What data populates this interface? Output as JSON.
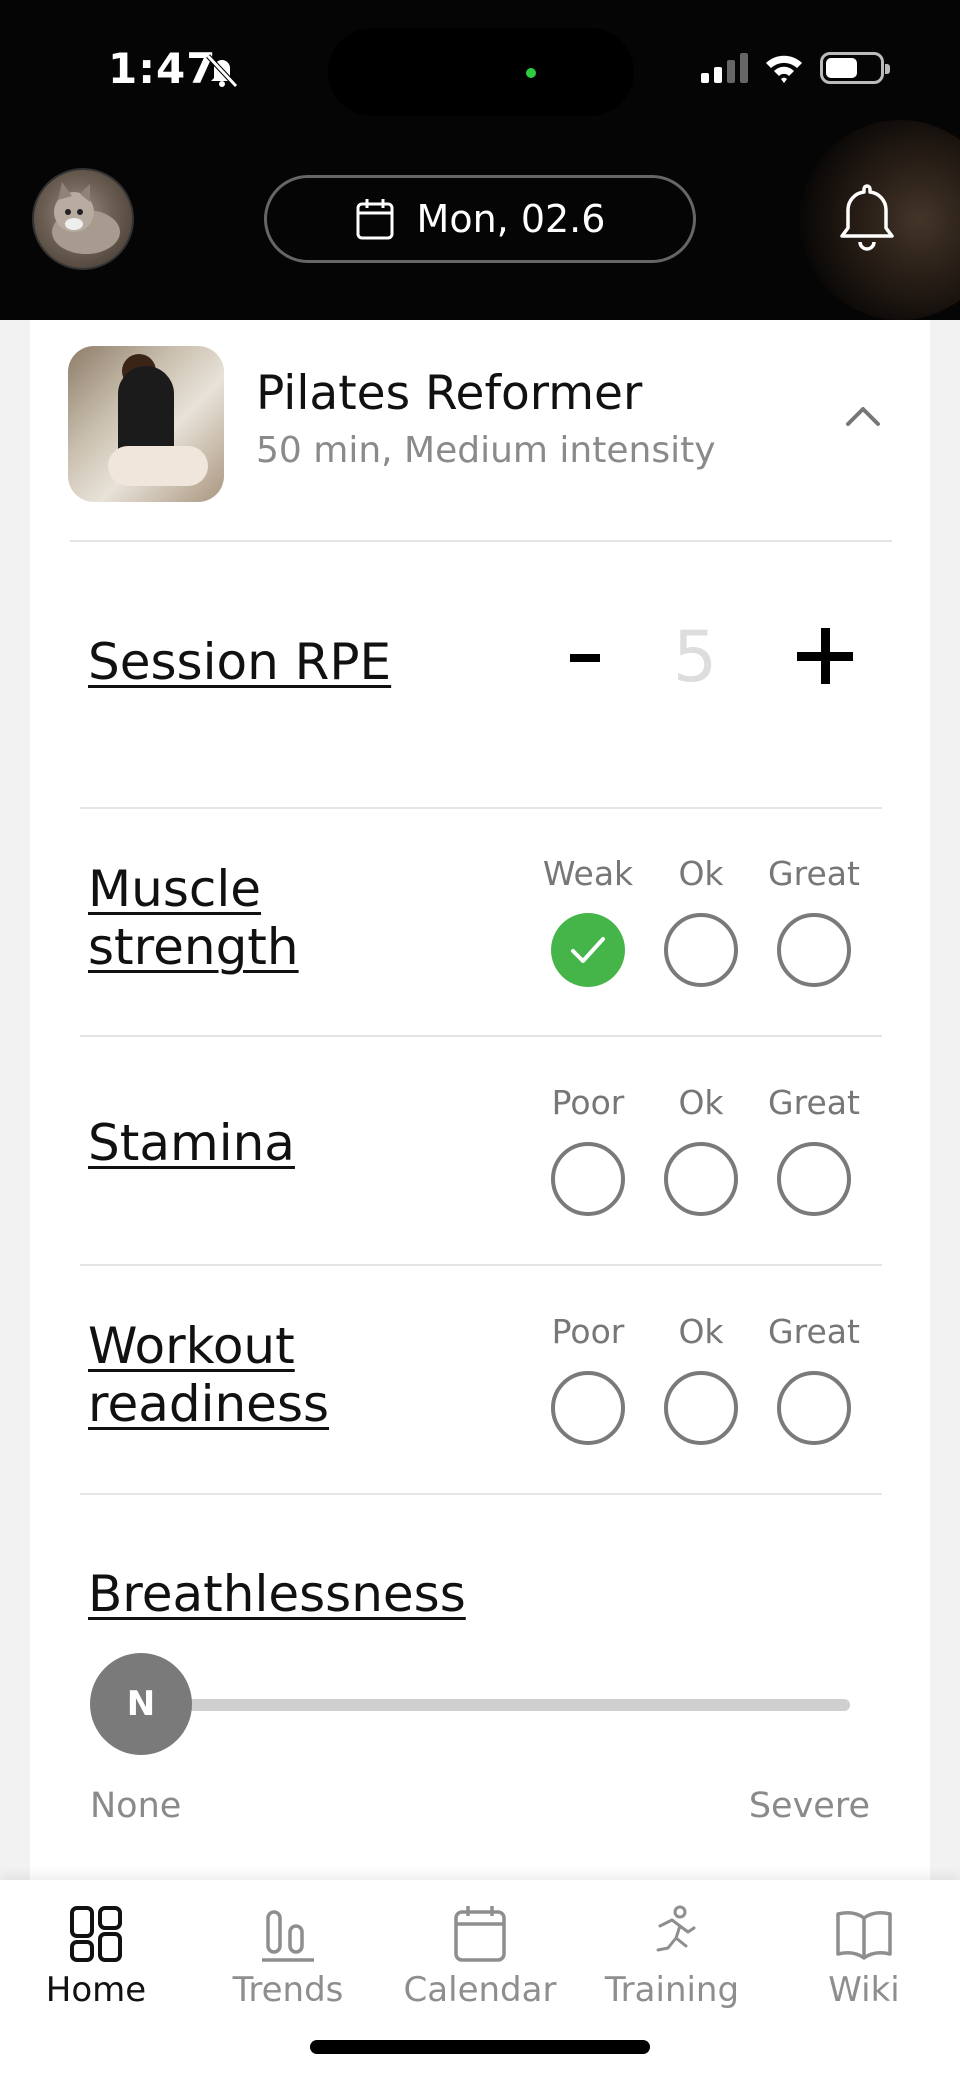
{
  "status_bar": {
    "time": "1:47"
  },
  "header": {
    "date": "Mon, 02.6",
    "icons": {
      "calendar": "calendar-icon",
      "notifications": "bell-icon",
      "silent": "bell-slash-icon"
    }
  },
  "activity": {
    "title": "Pilates Reformer",
    "subtitle": "50 min, Medium intensity"
  },
  "session_rpe": {
    "label": "Session RPE",
    "value": "5",
    "decrement": "-",
    "increment": "+"
  },
  "ratings": [
    {
      "label": "Muscle strength",
      "options": [
        "Weak",
        "Ok",
        "Great"
      ],
      "selected": 0
    },
    {
      "label": "Stamina",
      "options": [
        "Poor",
        "Ok",
        "Great"
      ],
      "selected": null
    },
    {
      "label": "Workout readiness",
      "options": [
        "Poor",
        "Ok",
        "Great"
      ],
      "selected": null
    }
  ],
  "breathlessness": {
    "label": "Breathlessness",
    "thumb": "N",
    "min_label": "None",
    "max_label": "Severe",
    "value_fraction": 0
  },
  "colors": {
    "selected": "#45b54a",
    "header_bg": "#050505"
  },
  "nav": [
    {
      "label": "Home",
      "icon": "home-grid-icon",
      "active": true
    },
    {
      "label": "Trends",
      "icon": "trends-icon",
      "active": false
    },
    {
      "label": "Calendar",
      "icon": "calendar-icon",
      "active": false
    },
    {
      "label": "Training",
      "icon": "runner-icon",
      "active": false
    },
    {
      "label": "Wiki",
      "icon": "book-icon",
      "active": false
    }
  ]
}
